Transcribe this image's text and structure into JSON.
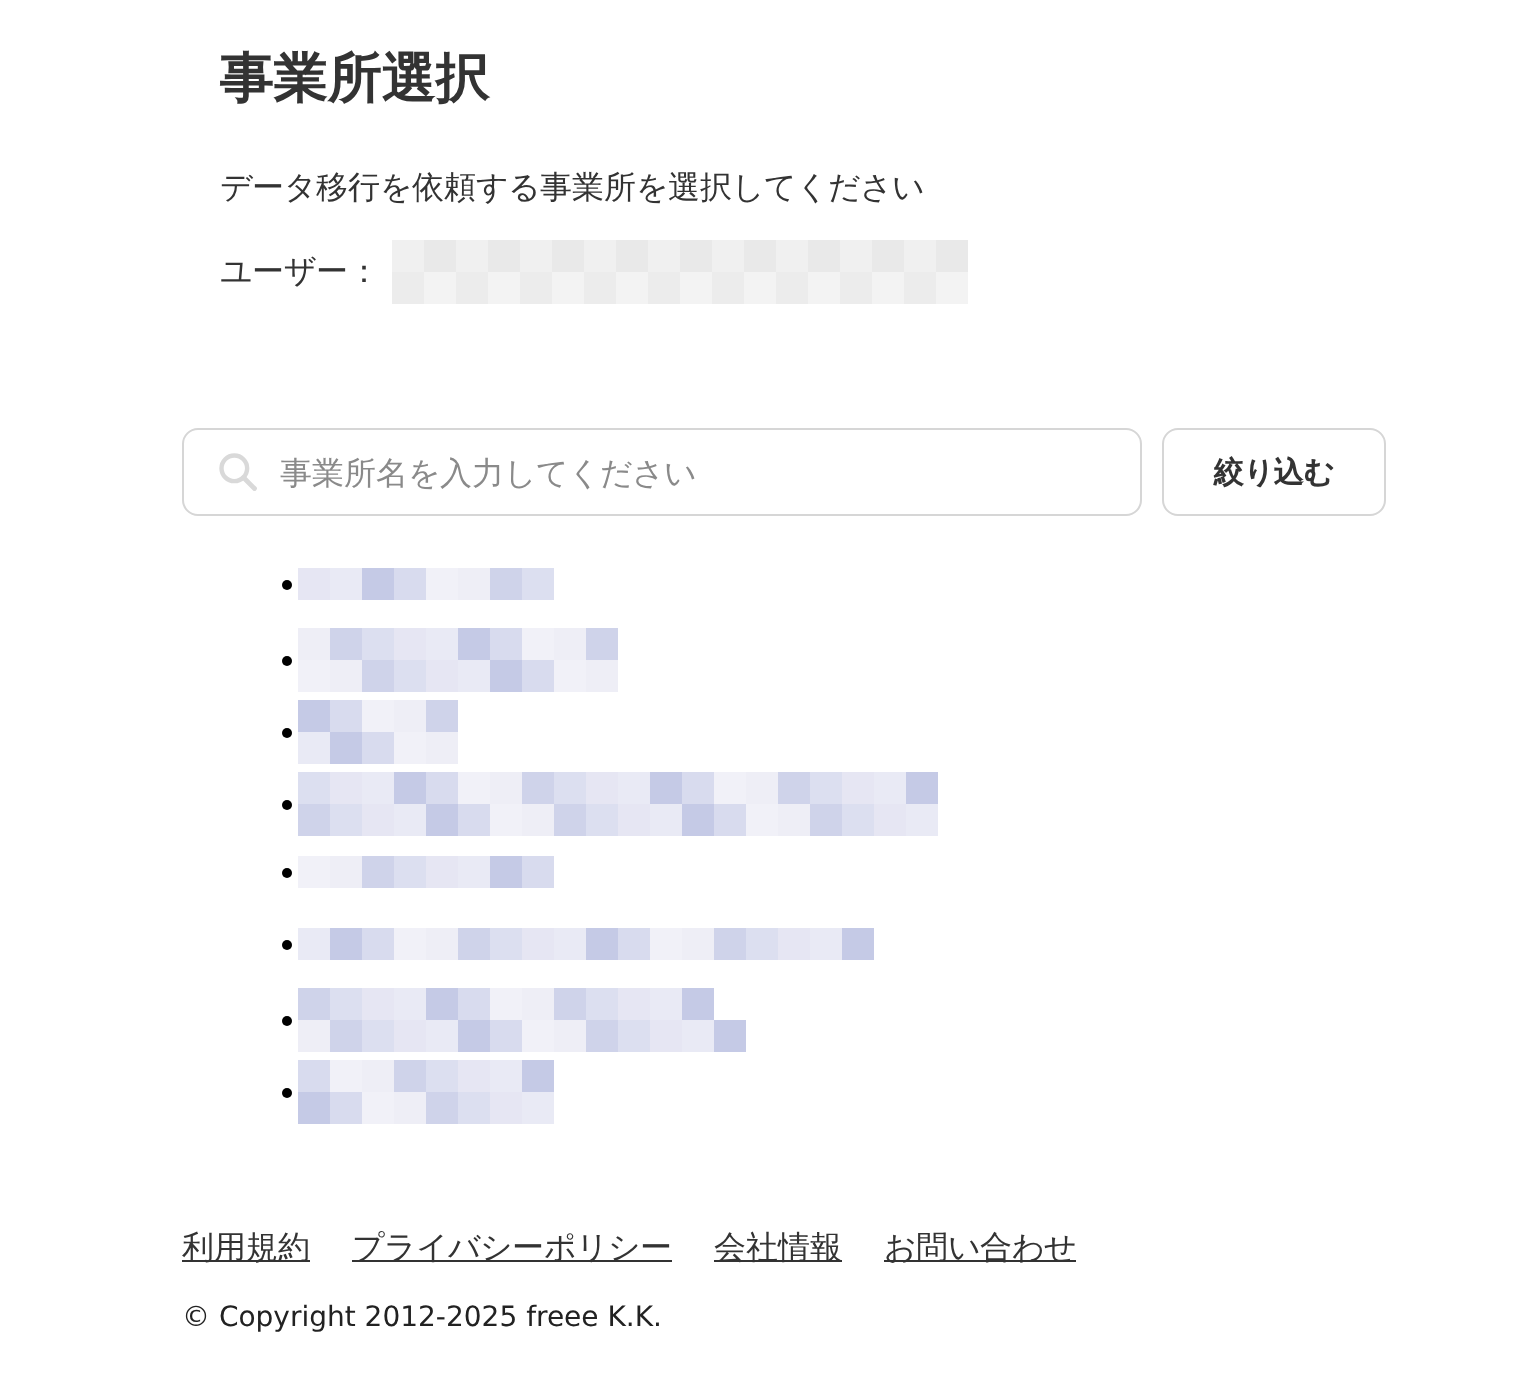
{
  "title": "事業所選択",
  "description": "データ移行を依頼する事業所を選択してください",
  "user_label": "ユーザー：",
  "search": {
    "placeholder": "事業所名を入力してください"
  },
  "filter_button": "絞り込む",
  "offices": [
    {
      "kind": "single"
    },
    {
      "kind": "double"
    },
    {
      "kind": "double"
    },
    {
      "kind": "double"
    },
    {
      "kind": "single"
    },
    {
      "kind": "single"
    },
    {
      "kind": "double"
    },
    {
      "kind": "double"
    }
  ],
  "footer_links": [
    "利用規約",
    "プライバシーポリシー",
    "会社情報",
    "お問い合わせ"
  ],
  "copyright": "© Copyright 2012-2025 freee K.K."
}
